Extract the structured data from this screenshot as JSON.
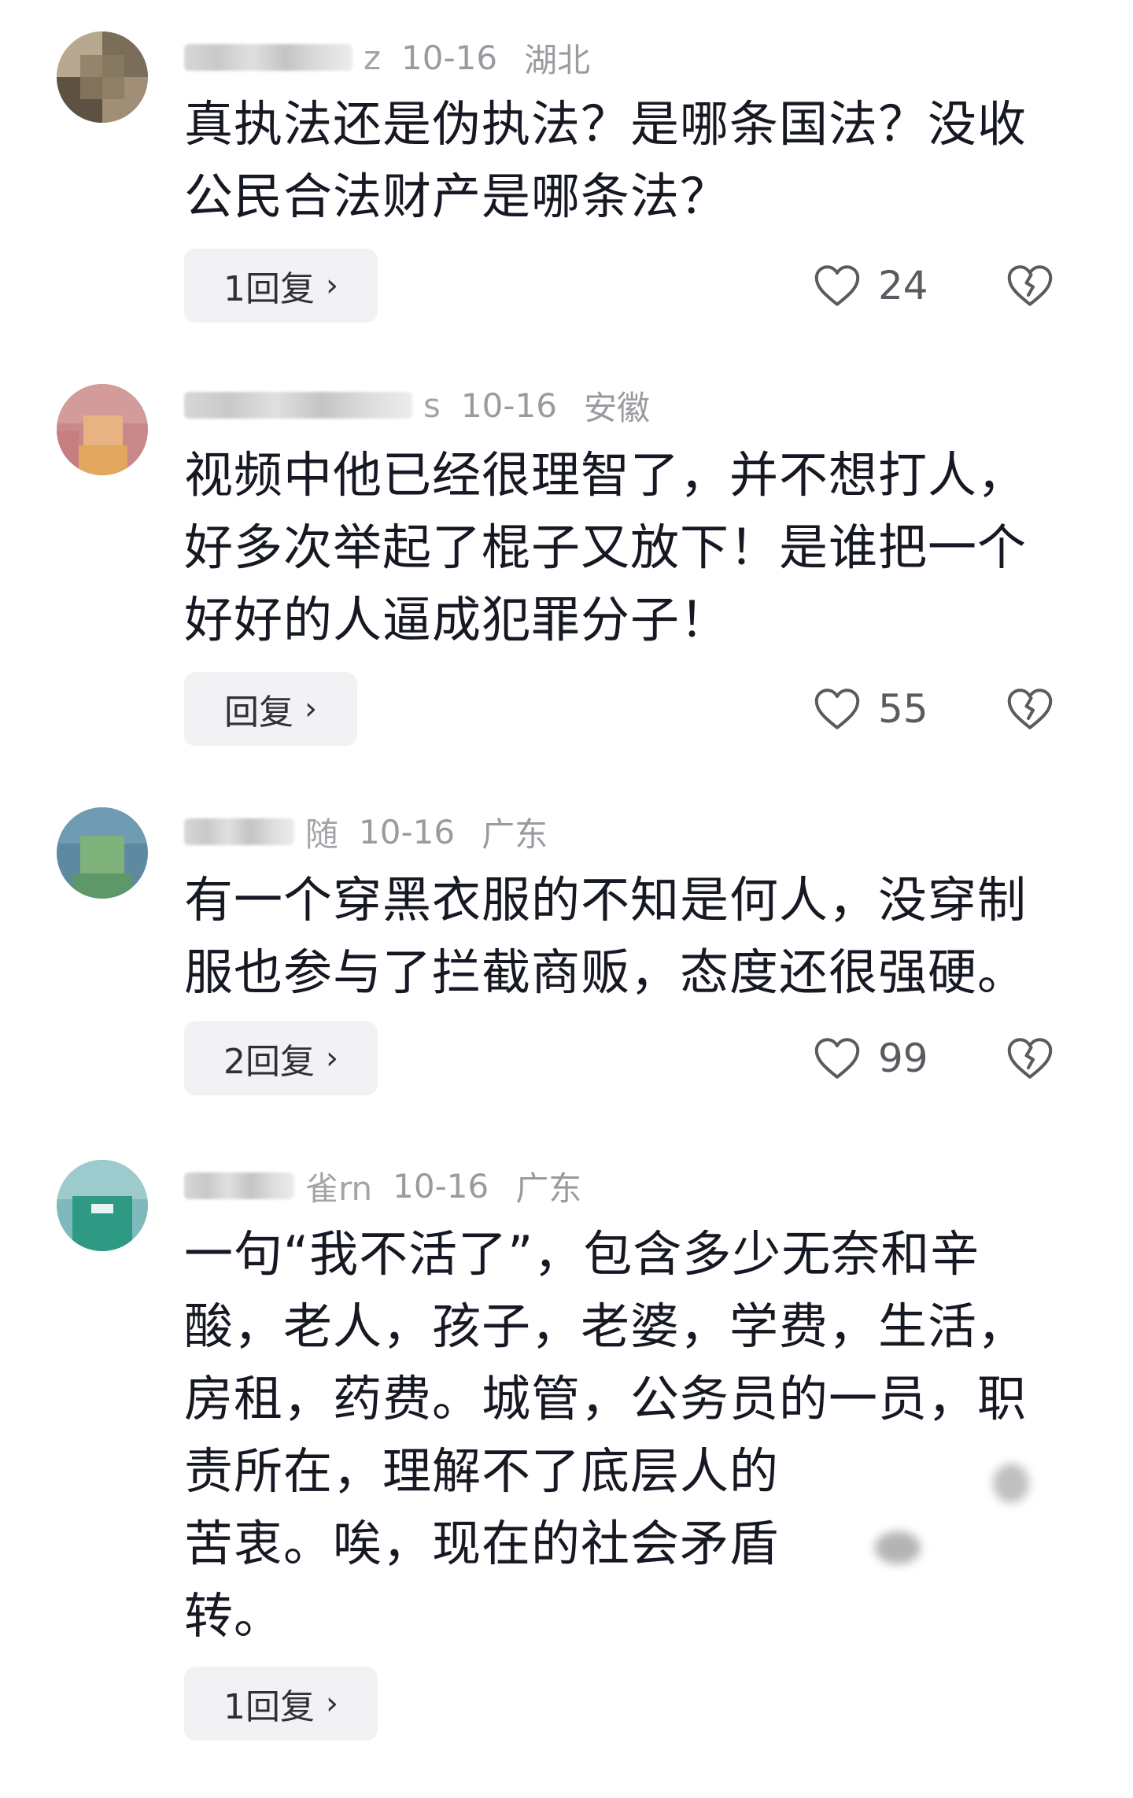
{
  "comments": [
    {
      "name_tail": "z",
      "date": "10-16",
      "region": "湖北",
      "text": "真执法还是伪执法？是哪条国法？没收\n公民合法财产是哪条法？",
      "reply_label": "1回复",
      "likes": "24",
      "avatar_icon": "pixelated-avatar-icon"
    },
    {
      "name_tail": "s",
      "date": "10-16",
      "region": "安徽",
      "text": "视频中他已经很理智了，并不想打人，\n好多次举起了棍子又放下！是谁把一个\n好好的人逼成犯罪分子！",
      "reply_label": "回复",
      "likes": "55",
      "avatar_icon": "pixelated-avatar-icon"
    },
    {
      "name_tail": "随",
      "date": "10-16",
      "region": "广东",
      "text": "有一个穿黑衣服的不知是何人，没穿制\n服也参与了拦截商贩，态度还很强硬。",
      "reply_label": "2回复",
      "likes": "99",
      "avatar_icon": "pixelated-avatar-icon"
    },
    {
      "name_tail": "雀rn",
      "date": "10-16",
      "region": "广东",
      "text": "一句“我不活了”，包含多少无奈和辛\n酸，老人，孩子，老婆，学费，生活，\n房租，药费。城管，公务员的一员，职\n责所在，理解不了底层人的\n苦衷。唉，现在的社会矛盾\n转。",
      "reply_label": "1回复",
      "avatar_icon": "pixelated-avatar-icon"
    }
  ],
  "icons": {
    "like": "heart-outline-icon",
    "dislike": "broken-heart-icon",
    "chevron": "chevron-right-icon"
  },
  "colors": {
    "text": "#161823",
    "meta": "#9a9ba0",
    "reply_bg": "#f2f2f4",
    "icon": "#5a5b60"
  }
}
